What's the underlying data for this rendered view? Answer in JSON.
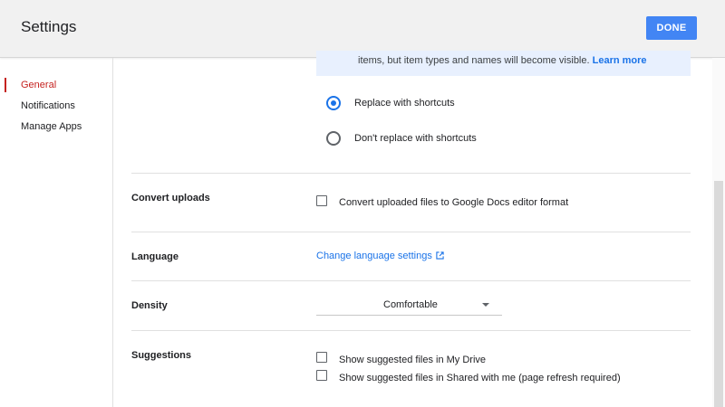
{
  "header": {
    "title": "Settings",
    "done_label": "DONE"
  },
  "sidebar": {
    "items": [
      {
        "label": "General",
        "active": true
      },
      {
        "label": "Notifications",
        "active": false
      },
      {
        "label": "Manage Apps",
        "active": false
      }
    ]
  },
  "shortcuts": {
    "info_text": "items, but item types and names will become visible.",
    "learn_more": "Learn more",
    "options": [
      {
        "label": "Replace with shortcuts",
        "selected": true
      },
      {
        "label": "Don't replace with shortcuts",
        "selected": false
      }
    ]
  },
  "convert_uploads": {
    "title": "Convert uploads",
    "option_label": "Convert uploaded files to Google Docs editor format",
    "checked": false
  },
  "language": {
    "title": "Language",
    "link_label": "Change language settings"
  },
  "density": {
    "title": "Density",
    "value": "Comfortable"
  },
  "suggestions": {
    "title": "Suggestions",
    "options": [
      {
        "label": "Show suggested files in My Drive",
        "checked": false
      },
      {
        "label": "Show suggested files in Shared with me (page refresh required)",
        "checked": false
      }
    ]
  },
  "colors": {
    "accent": "#1a73e8",
    "done_button": "#4285f4",
    "active_nav": "#c5221f",
    "info_background": "#e8f0fe"
  },
  "icons": {
    "external_link": "external-link-icon",
    "dropdown": "chevron-down-icon"
  }
}
